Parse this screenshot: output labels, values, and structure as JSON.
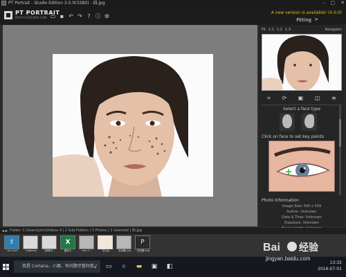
{
  "window": {
    "title": "PT Portrait - Studio Edition 3.0.0(32Bit) - 四.jpg",
    "controls": [
      "–",
      "□",
      "✕"
    ]
  },
  "header": {
    "brand": "PT PORTRAIT",
    "brand_sub": "PHOTO-TOOLBOX.COM",
    "version_notice": "A new version is available! (4.0.0)",
    "mode": "Fitting",
    "mode_arrow": ">"
  },
  "toolbar": {
    "icons": [
      "folder-open-icon",
      "save-icon",
      "undo-icon",
      "redo-icon",
      "help-icon",
      "info-icon",
      "settings-icon"
    ]
  },
  "right_panel": {
    "zoom_tabs": [
      "Fit",
      "1:1",
      "1:2",
      "1:3"
    ],
    "navigator_label": "Navigator",
    "tools": [
      "crop-icon",
      "rotate-icon",
      "fit-icon",
      "compare-icon",
      "menu-icon"
    ],
    "face_type_label": "Select a face type",
    "keypoints_label": "Click on face to set key points",
    "info_title": "Photo Information",
    "info_lines": [
      "Image Size: 500 x 539",
      "Author: Unknown",
      "Date & Time: Unknown",
      "Exposure: Unknown",
      "Focal Length: Unknown"
    ]
  },
  "pathbar": {
    "nav_arrows": "◂ ▸",
    "text": "Folder:  C:\\Users\\john\\Videos 4  |  2 Sub-Folders  |  5 Photos  |  1 Selected  |  四.jpg"
  },
  "files": [
    {
      "label": "Up Level",
      "kind": "up",
      "glyph": "⇧"
    },
    {
      "label": "Captures",
      "kind": "folder",
      "glyph": ""
    },
    {
      "label": "[剪辑下...",
      "kind": "folder",
      "glyph": ""
    },
    {
      "label": "图标d...",
      "kind": "excel",
      "glyph": "X"
    },
    {
      "label": "coin 2 ...",
      "kind": "photo2",
      "glyph": ""
    },
    {
      "label": "四.jpg",
      "kind": "photo",
      "glyph": ""
    },
    {
      "label": "无标题.png",
      "kind": "photo2",
      "glyph": ""
    },
    {
      "label": "无标题.png",
      "kind": "dark",
      "glyph": "P"
    }
  ],
  "taskbar": {
    "search_placeholder": "我是 Cortana，小娜。有问题尽管问我。",
    "time": "13:32",
    "date": "2016-07-01"
  }
}
